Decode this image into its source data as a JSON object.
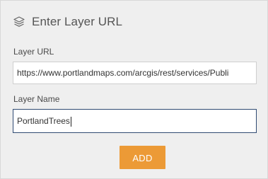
{
  "header": {
    "icon": "layers-icon",
    "title": "Enter Layer URL"
  },
  "form": {
    "url_label": "Layer URL",
    "url_value": "https://www.portlandmaps.com/arcgis/rest/services/Publi",
    "name_label": "Layer Name",
    "name_value": "PortlandTrees"
  },
  "actions": {
    "add_label": "ADD"
  },
  "colors": {
    "panel_background": "#efefef",
    "accent_button": "#ec9a36",
    "focused_border": "#2f4a72"
  }
}
